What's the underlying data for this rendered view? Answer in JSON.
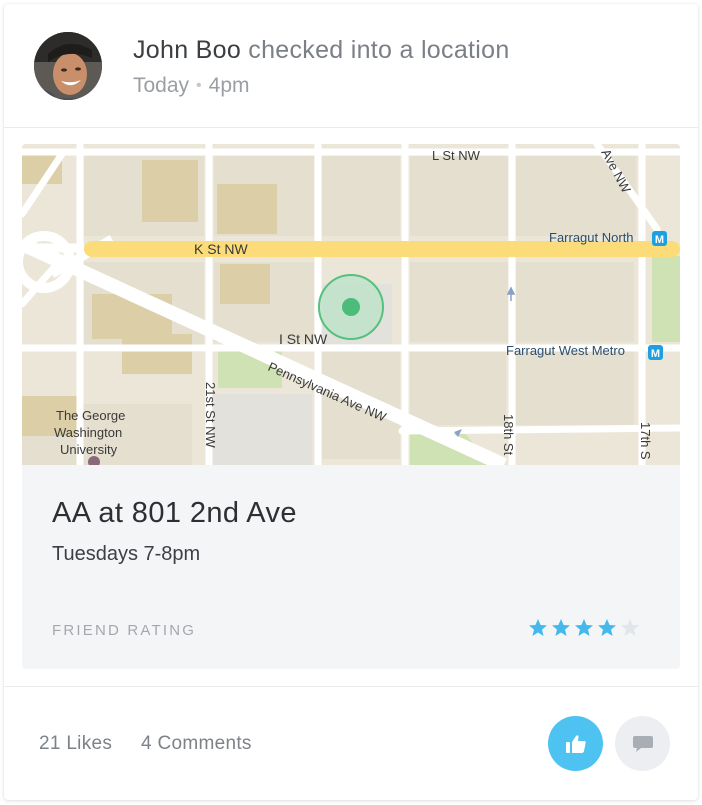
{
  "post": {
    "author": "John Boo",
    "action": " checked into a location",
    "day": "Today",
    "separator": "•",
    "time": "4pm"
  },
  "map": {
    "streets": {
      "l_st": "L St NW",
      "k_st": "K St NW",
      "i_st": "I St NW",
      "pennsylvania": "Pennsylvania Ave NW",
      "st21": "21st St NW",
      "st18": "18th St",
      "st17": "17th S",
      "ave_nw": "Ave NW"
    },
    "places": {
      "farragut_north": "Farragut North",
      "farragut_west": "Farragut West Metro",
      "gwu_line1": "The George",
      "gwu_line2": "Washington",
      "gwu_line3": "University",
      "metro_symbol": "M"
    },
    "colors": {
      "land": "#ece6d8",
      "block": "#e6e0d0",
      "building": "#ddd0a8",
      "road": "#ffffff",
      "major_road": "#fbdd7a",
      "park": "#cfe3b4",
      "pin": "#4cbc7a",
      "metro": "#1ba0e2"
    }
  },
  "location": {
    "title": "AA at 801 2nd Ave",
    "schedule": "Tuesdays 7-8pm",
    "rating_label": "FRIEND RATING",
    "rating": 4,
    "rating_max": 5
  },
  "footer": {
    "likes": "21 Likes",
    "comments": "4 Comments",
    "like_icon": "thumbs-up-icon",
    "comment_icon": "speech-bubble-icon"
  },
  "theme": {
    "accent": "#4ec3f1",
    "star_on": "#45b9ec",
    "star_off": "#e2e5e9"
  }
}
